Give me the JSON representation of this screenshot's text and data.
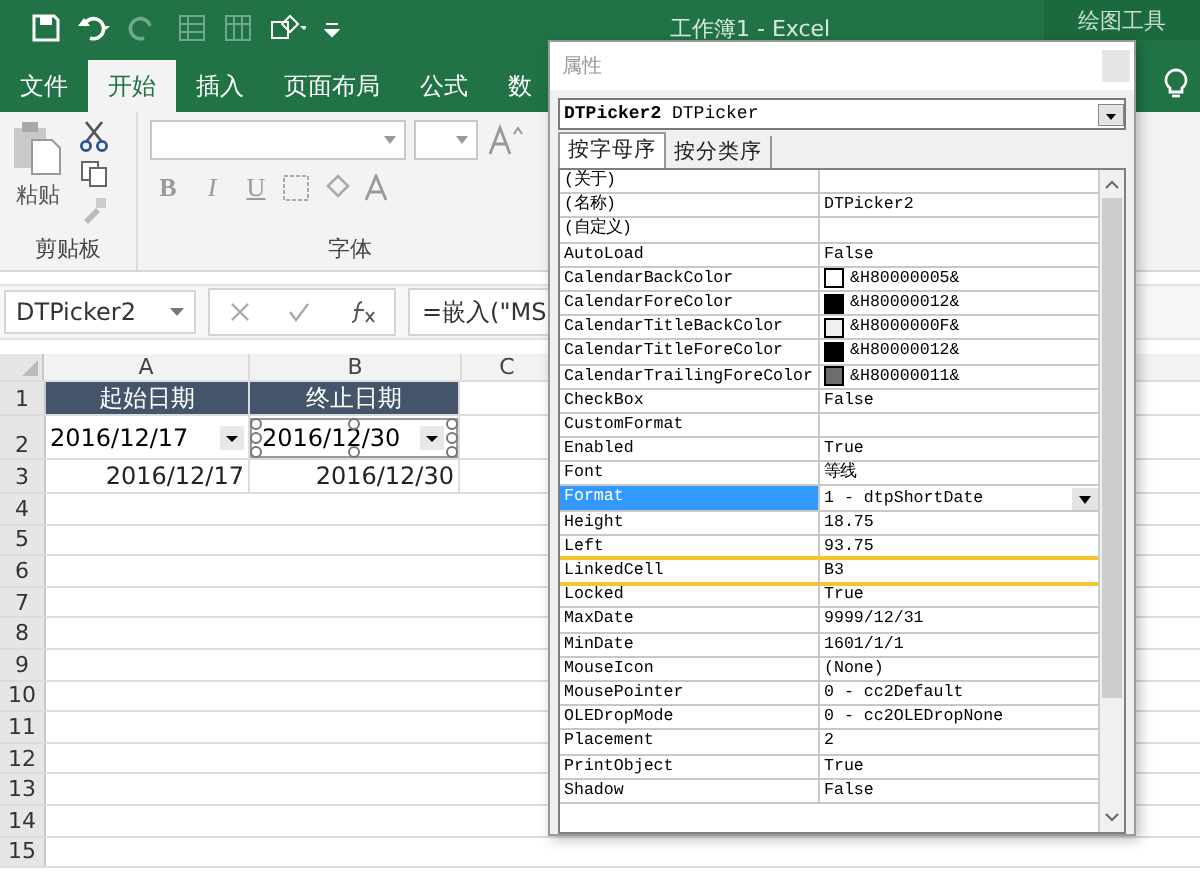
{
  "title_bar": {
    "title": "工作簿1 - Excel",
    "context_tab": "绘图工具"
  },
  "ribbon_tabs": [
    {
      "label": "文件",
      "selected": false
    },
    {
      "label": "开始",
      "selected": true
    },
    {
      "label": "插入",
      "selected": false
    },
    {
      "label": "页面布局",
      "selected": false
    },
    {
      "label": "公式",
      "selected": false
    },
    {
      "label": "数",
      "selected": false
    }
  ],
  "ribbon": {
    "clipboard": {
      "paste_label": "粘贴",
      "group_label": "剪贴板"
    },
    "font": {
      "group_label": "字体",
      "bold": "B",
      "italic": "I",
      "underline": "U"
    }
  },
  "formula_bar": {
    "name_box": "DTPicker2",
    "formula": "=嵌入(\"MS"
  },
  "sheet": {
    "columns": [
      "A",
      "B",
      "C"
    ],
    "rows": [
      {
        "number": "1",
        "cells": [
          {
            "kind": "header",
            "text": "起始日期"
          },
          {
            "kind": "header",
            "text": "终止日期"
          }
        ]
      },
      {
        "number": "2",
        "cells": [
          {
            "kind": "picker",
            "text": "2016/12/17",
            "selected": false
          },
          {
            "kind": "picker",
            "text": "2016/12/30",
            "selected": true
          }
        ]
      },
      {
        "number": "3",
        "cells": [
          {
            "kind": "date",
            "text": "2016/12/17"
          },
          {
            "kind": "date",
            "text": "2016/12/30"
          }
        ]
      },
      {
        "number": "4"
      },
      {
        "number": "5"
      },
      {
        "number": "6"
      },
      {
        "number": "7"
      },
      {
        "number": "8"
      },
      {
        "number": "9"
      },
      {
        "number": "10"
      },
      {
        "number": "11"
      },
      {
        "number": "12"
      },
      {
        "number": "13"
      },
      {
        "number": "14"
      },
      {
        "number": "15"
      }
    ]
  },
  "dialog": {
    "title": "属性",
    "object": "**DTPicker2** DTPicker",
    "tabs": [
      {
        "label": "按字母序",
        "selected": true
      },
      {
        "label": "按分类序",
        "selected": false
      }
    ],
    "properties": [
      {
        "name": "(关于)",
        "kind": "text",
        "selected": false,
        "highlighted": false
      },
      {
        "name": "(名称)",
        "value": "DTPicker2",
        "kind": "text",
        "selected": false,
        "highlighted": false
      },
      {
        "name": "(自定义)",
        "kind": "text",
        "selected": false,
        "highlighted": false
      },
      {
        "name": "AutoLoad",
        "value": "False",
        "kind": "text",
        "selected": false,
        "highlighted": false
      },
      {
        "name": "CalendarBackColor",
        "value": "&H80000005&",
        "kind": "color",
        "color": "#ffffff",
        "selected": false,
        "highlighted": false
      },
      {
        "name": "CalendarForeColor",
        "value": "&H80000012&",
        "kind": "color",
        "color": "#000000",
        "selected": false,
        "highlighted": false
      },
      {
        "name": "CalendarTitleBackColor",
        "value": "&H8000000F&",
        "kind": "color",
        "color": "#f0f0f0",
        "selected": false,
        "highlighted": false
      },
      {
        "name": "CalendarTitleForeColor",
        "value": "&H80000012&",
        "kind": "color",
        "color": "#000000",
        "selected": false,
        "highlighted": false
      },
      {
        "name": "CalendarTrailingForeColor",
        "value": "&H80000011&",
        "kind": "color",
        "color": "#6d6d6d",
        "selected": false,
        "highlighted": false
      },
      {
        "name": "CheckBox",
        "value": "False",
        "kind": "text",
        "selected": false,
        "highlighted": false
      },
      {
        "name": "CustomFormat",
        "kind": "text",
        "selected": false,
        "highlighted": false
      },
      {
        "name": "Enabled",
        "value": "True",
        "kind": "text",
        "selected": false,
        "highlighted": false
      },
      {
        "name": "Font",
        "value": "等线",
        "kind": "text",
        "selected": false,
        "highlighted": false
      },
      {
        "name": "Format",
        "value": "1 - dtpShortDate",
        "kind": "dropdown",
        "selected": true,
        "highlighted": false
      },
      {
        "name": "Height",
        "value": "18.75",
        "kind": "text",
        "selected": false,
        "highlighted": false
      },
      {
        "name": "Left",
        "value": "93.75",
        "kind": "text",
        "selected": false,
        "highlighted": false
      },
      {
        "name": "LinkedCell",
        "value": "B3",
        "kind": "text",
        "selected": false,
        "highlighted": true
      },
      {
        "name": "Locked",
        "value": "True",
        "kind": "text",
        "selected": false,
        "highlighted": false
      },
      {
        "name": "MaxDate",
        "value": "9999/12/31",
        "kind": "text",
        "selected": false,
        "highlighted": false
      },
      {
        "name": "MinDate",
        "value": "1601/1/1",
        "kind": "text",
        "selected": false,
        "highlighted": false
      },
      {
        "name": "MouseIcon",
        "value": "(None)",
        "kind": "text",
        "selected": false,
        "highlighted": false
      },
      {
        "name": "MousePointer",
        "value": "0 - cc2Default",
        "kind": "text",
        "selected": false,
        "highlighted": false
      },
      {
        "name": "OLEDropMode",
        "value": "0 - cc2OLEDropNone",
        "kind": "text",
        "selected": false,
        "highlighted": false
      },
      {
        "name": "Placement",
        "value": "2",
        "kind": "text",
        "selected": false,
        "highlighted": false
      },
      {
        "name": "PrintObject",
        "value": "True",
        "kind": "text",
        "selected": false,
        "highlighted": false
      },
      {
        "name": "Shadow",
        "value": "False",
        "kind": "text",
        "selected": false,
        "highlighted": false
      }
    ]
  }
}
